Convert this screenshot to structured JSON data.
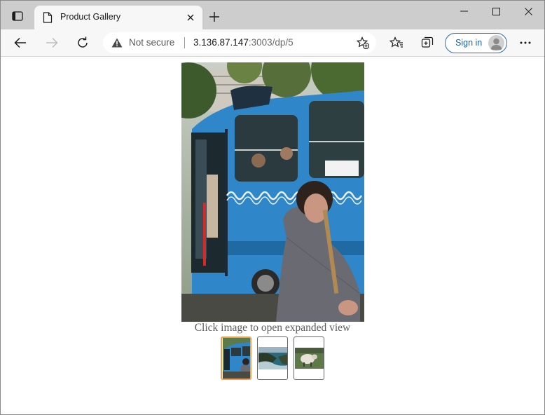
{
  "browser": {
    "tab": {
      "title": "Product Gallery"
    },
    "address": {
      "security_label": "Not secure",
      "url_host": "3.136.87.147",
      "url_rest": ":3003/dp/5"
    },
    "signin_label": "Sign in"
  },
  "gallery": {
    "caption": "Click image to open expanded view",
    "selected_index": 0,
    "thumbnails": [
      "tram",
      "coast",
      "sheep"
    ]
  },
  "colors": {
    "tram_blue": "#2f86c8",
    "accent_selected": "#f0a050",
    "signin_blue": "#2a6fb6"
  }
}
